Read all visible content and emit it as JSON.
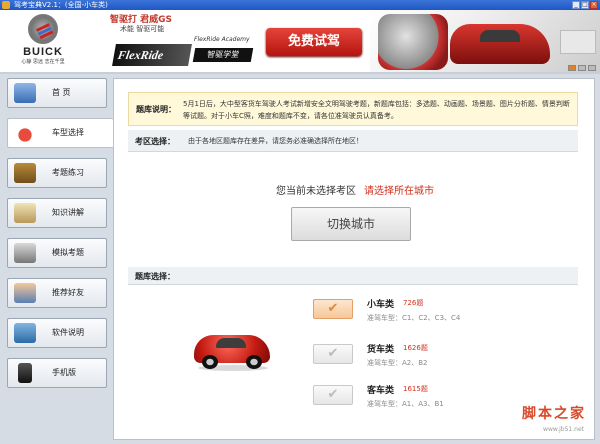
{
  "window": {
    "title": "驾考宝典V2.1：(全国-小车类)",
    "controls": [
      "_",
      "□",
      "×"
    ]
  },
  "banner": {
    "brand": "BUICK",
    "brand_tagline": "心静 思远 志在千里",
    "slogan_line1": "智驱打 君威GS",
    "slogan_line2": "术能 智驱可能",
    "flexride": "FlexRide",
    "flexride_sub": "FlexRide Academy",
    "flexride_cn": "智驱学堂",
    "trial_button": "免费试驾"
  },
  "sidebar": {
    "items": [
      {
        "label": "首  页",
        "icon": "home-icon"
      },
      {
        "label": "车型选择",
        "icon": "car-icon",
        "active": true
      },
      {
        "label": "考题练习",
        "icon": "book-icon"
      },
      {
        "label": "知识讲解",
        "icon": "notebook-icon"
      },
      {
        "label": "模拟考题",
        "icon": "exam-icon"
      },
      {
        "label": "推荐好友",
        "icon": "user-icon"
      },
      {
        "label": "软件说明",
        "icon": "help-icon"
      },
      {
        "label": "手机版",
        "icon": "phone-icon"
      }
    ]
  },
  "notice": {
    "label": "题库说明：",
    "body": "5月1日后，大中型客货车驾驶人考试新增安全文明驾驶考题，新题库包括：多选题、动画题、场景题、图片分析题、情景判断等试题。对于小车C照，难度和题库不变，请各位准驾驶员认真备考。"
  },
  "region": {
    "label": "考区选择：",
    "body": "由于各地区题库存在差异，请您务必准确选择所在地区！"
  },
  "current": {
    "prefix": "您当前未选择考区",
    "link": "请选择所在城市"
  },
  "switch_button": "切换城市",
  "bank": {
    "label": "题库选择：",
    "options": [
      {
        "name": "小车类",
        "count": "726题",
        "types": "准驾车型：C1、C2、C3、C4",
        "selected": true
      },
      {
        "name": "货车类",
        "count": "1626题",
        "types": "准驾车型：A2、B2",
        "selected": false
      },
      {
        "name": "客车类",
        "count": "1615题",
        "types": "准驾车型：A1、A3、B1",
        "selected": false
      }
    ]
  },
  "watermark": {
    "text": "脚本之家",
    "url": "www.jb51.net"
  },
  "colors": {
    "accent_red": "#d0301c",
    "titlebar_blue": "#1f57c4",
    "notice_bg": "#fff8d9"
  }
}
